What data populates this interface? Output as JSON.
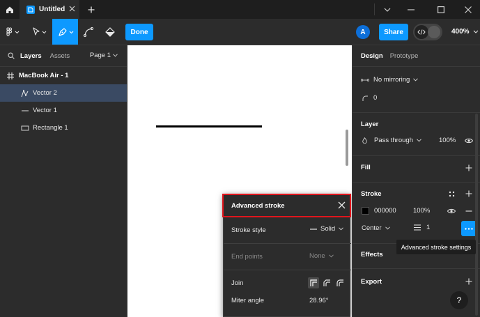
{
  "titlebar": {
    "tab_name": "Untitled"
  },
  "toolbar": {
    "done_label": "Done",
    "avatar_initial": "A",
    "share_label": "Share",
    "zoom": "400%"
  },
  "layers_panel": {
    "tabs": [
      "Layers",
      "Assets"
    ],
    "page_selector": "Page 1",
    "frame_name": "MacBook Air - 1",
    "layers": [
      {
        "name": "Vector 2",
        "icon": "vector-path-icon"
      },
      {
        "name": "Vector 1",
        "icon": "line-icon"
      },
      {
        "name": "Rectangle 1",
        "icon": "rectangle-icon"
      }
    ]
  },
  "advanced_stroke": {
    "title": "Advanced stroke",
    "stroke_style_label": "Stroke style",
    "stroke_style_value": "Solid",
    "end_points_label": "End points",
    "end_points_value": "None",
    "join_label": "Join",
    "miter_angle_label": "Miter angle",
    "miter_angle_value": "28.96°"
  },
  "design_panel": {
    "tabs": [
      "Design",
      "Prototype"
    ],
    "mirroring": "No mirroring",
    "corner_radius": "0",
    "layer_title": "Layer",
    "blend_mode": "Pass through",
    "layer_opacity": "100%",
    "fill_title": "Fill",
    "stroke_title": "Stroke",
    "stroke_color": "000000",
    "stroke_opacity": "100%",
    "stroke_position": "Center",
    "stroke_weight": "1",
    "effects_title": "Effects",
    "export_title": "Export",
    "tooltip": "Advanced stroke settings",
    "help": "?"
  },
  "colors": {
    "accent": "#0d99ff",
    "panel": "#2c2c2c",
    "highlight": "#e0151c",
    "stroke": "#000000"
  }
}
